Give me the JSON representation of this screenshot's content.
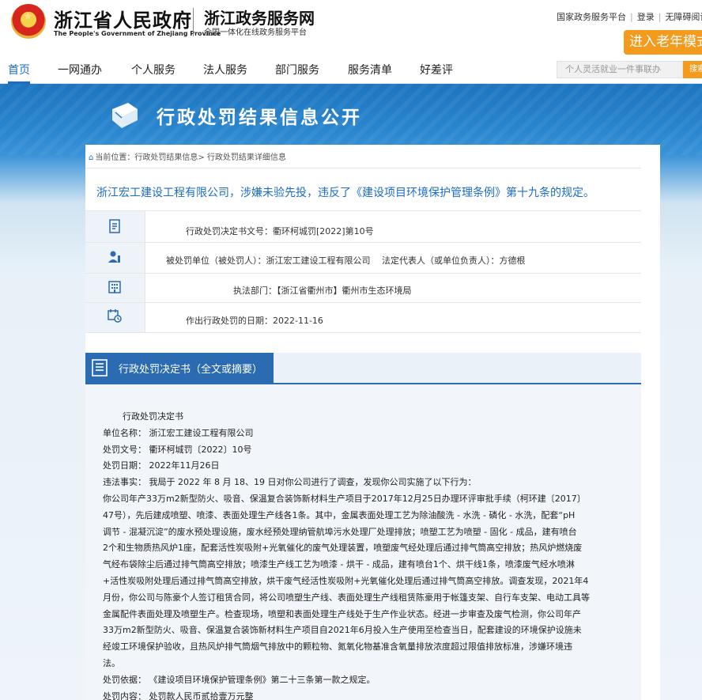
{
  "header": {
    "gov_title": "浙江省人民政府",
    "gov_subtitle": "The People's Government of Zhejiang Province",
    "service_title": "浙江政务服务网",
    "service_subtitle": "全国一体化在线政务服务平台",
    "links": [
      "国家政务服务平台",
      "登录",
      "无障碍阅读"
    ],
    "elder_mode": "进入老年模式"
  },
  "nav": {
    "items": [
      "首页",
      "一网通办",
      "个人服务",
      "法人服务",
      "部门服务",
      "服务清单",
      "好差评"
    ],
    "active_index": 0,
    "search_placeholder": "个人灵活就业一件事联办",
    "search_button": "搜索"
  },
  "banner": {
    "title": "行政处罚结果信息公开"
  },
  "breadcrumb": {
    "label": "当前位置：",
    "parts": [
      "行政处罚结果信息>",
      "行政处罚结果详细信息"
    ]
  },
  "headline": "浙江宏工建设工程有限公司，涉嫌未验先投，违反了《建设项目环境保护管理条例》第十九条的规定。",
  "info": {
    "decision_no": "行政处罚决定书文号：衢环柯城罚[2022]第10号",
    "punished": "被处罚单位（被处罚人）：浙江宏工建设工程有限公司　 法定代表人（或单位负责人）：方德根",
    "department": "执法部门：【浙江省衢州市】衢州市生态环境局",
    "date": "作出行政处罚的日期：2022-11-16"
  },
  "section": {
    "title": "行政处罚决定书（全文或摘要）"
  },
  "document": {
    "lines": [
      "行政处罚决定书",
      "单位名称： 浙江宏工建设工程有限公司",
      "处罚文号： 衢环柯城罚〔2022〕10号",
      "处罚日期： 2022年11月26日",
      "违法事实： 我局于 2022 年 8 月 18、19 日对你公司进行了调查，发现你公司实施了以下行为：",
      "你公司年产33万m2新型防火、吸音、保温复合装饰新材料生产项目于2017年12月25日办理环评审批手续（柯环建〔2017〕",
      "47号），先后建成喷塑、喷漆、表面处理生产线各1条。其中，金属表面处理工艺为除油酸洗 - 水洗 - 磷化 - 水洗，配套“pH",
      "调节 - 混凝沉淀”的废水预处理设施，废水经预处理纳管航埠污水处理厂处理排放；喷塑工艺为喷塑 - 固化 - 成品，建有喷台",
      "2个和生物质热风炉1座，配套活性炭吸附+光氧催化的废气处理装置，喷塑废气经处理后通过排气筒高空排放；热风炉燃烧废",
      "气经布袋除尘后通过排气筒高空排放；喷漆生产线工艺为喷漆 - 烘干 - 成品，建有喷台1个、烘干线1条，喷漆废气经水喷淋",
      "+活性炭吸附处理后通过排气筒高空排放，烘干废气经活性炭吸附+光氧催化处理后通过排气筒高空排放。调查发现，2021年4",
      "月份，你公司与陈豪个人签订租赁合同，将公司喷塑生产线、表面处理生产线租赁陈豪用于帐篷支架、自行车支架、电动工具等",
      "金属配件表面处理及喷塑生产。检查现场，喷塑和表面处理生产线处于生产作业状态。经进一步审查及废气检测，你公司年产",
      "33万m2新型防火、吸音、保温复合装饰新材料生产项目自2021年6月投入生产使用至检查当日，配套建设的环境保护设施未",
      "经竣工环境保护验收，且热风炉排气筒烟气排放中的颗粒物、氮氧化物基准含氧量排放浓度超过限值排放标准，涉嫌环境违",
      "法。",
      "处罚依据： 《建设项目环境保护管理条例》第二十三条第一款之规定。",
      "处罚内容： 处罚款人民币贰拾壹万元整"
    ]
  }
}
